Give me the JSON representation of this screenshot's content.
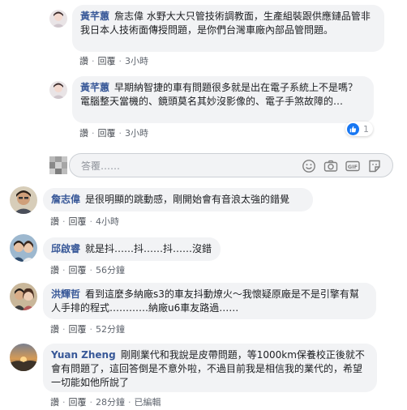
{
  "colors": {
    "author": "#385898",
    "bubble": "#f2f3f5",
    "meta": "#616770",
    "like": "#1877f2"
  },
  "labels": {
    "like": "讚",
    "reply": "回覆",
    "sep": "·"
  },
  "reply_box": {
    "placeholder": "答覆……",
    "icons": [
      "smiley-icon",
      "camera-icon",
      "gif-icon",
      "sticker-icon"
    ]
  },
  "replies": [
    {
      "author": "黃芊蕙",
      "text": "詹志偉 水野大大只管技術調教面，生產組裝跟供應鏈品管非我日本人技術面傳授問題，是你們台灣車廠內部品管問題。",
      "time": "3小時"
    },
    {
      "author": "黃芊蕙",
      "text": "早期納智捷的車有問題很多就是出在電子系統上不是嗎？電腦整天當機的、鏡頭莫名其妙沒影像的、電子手煞故障的…",
      "time": "3小時",
      "reaction_icon": "like-icon",
      "reaction_count": "1"
    }
  ],
  "comments": [
    {
      "author": "詹志偉",
      "text": "是很明顯的跳動感，剛開始會有音浪太強的錯覺",
      "time": "4小時"
    },
    {
      "author": "邱啟睿",
      "text": "就是抖……抖……抖……沒錯",
      "time": "56分鐘"
    },
    {
      "author": "洪輝哲",
      "text": "看到這麼多納廠s3的車友抖動燎火～我懷疑原廠是不是引擎有幫人手排的程式…………納廠u6車友路過……",
      "time": "52分鐘"
    },
    {
      "author": "Yuan Zheng",
      "text": "剛剛業代和我說是皮帶問題，等1000km保養校正後就不會有問題了，這回答倒是不意外啦，不過目前我是相信我的業代的，希望一切能如他所說了",
      "time": "28分鐘",
      "edited": "已編輯"
    }
  ]
}
